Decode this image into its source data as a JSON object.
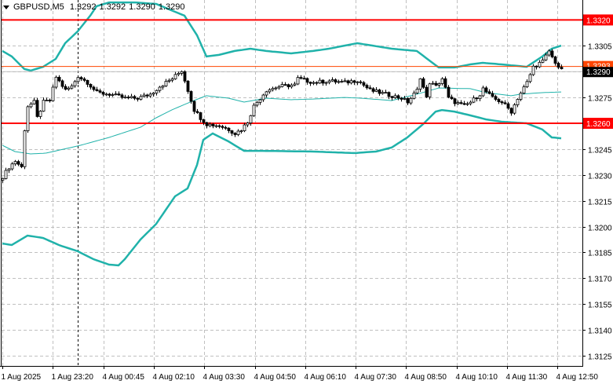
{
  "header": {
    "symbol": "GBPUSD,M5",
    "open": "1.3292",
    "high": "1.3292",
    "low": "1.3290",
    "close": "1.3290"
  },
  "colors": {
    "band": "#20b2aa",
    "level": "#ff0000",
    "bid_line": "#ff4500",
    "last_line": "#c0c0c0",
    "grid": "#c0c0c0",
    "candle_up": "#ffffff",
    "candle_down": "#000000"
  },
  "chart_data": {
    "type": "candlestick",
    "title": "GBPUSD,M5",
    "ylim": [
      1.3118,
      1.3332
    ],
    "y_ticks": [
      "1.3305",
      "1.3290",
      "1.3275",
      "1.3260",
      "1.3245",
      "1.3230",
      "1.3215",
      "1.3200",
      "1.3185",
      "1.3170",
      "1.3155",
      "1.3140",
      "1.3125"
    ],
    "x_ticks": [
      "1 Aug 2025",
      "1 Aug 23:20",
      "4 Aug 00:45",
      "4 Aug 02:10",
      "4 Aug 03:30",
      "4 Aug 04:50",
      "4 Aug 06:10",
      "4 Aug 07:30",
      "4 Aug 08:50",
      "4 Aug 10:10",
      "4 Aug 11:30",
      "4 Aug 12:50"
    ],
    "bar_count": 179,
    "close_keypoints": [
      [
        0,
        1.3229
      ],
      [
        2,
        1.32345
      ],
      [
        4,
        1.32381
      ],
      [
        6,
        1.32345
      ],
      [
        7,
        1.32564
      ],
      [
        8,
        1.327
      ],
      [
        10,
        1.32723
      ],
      [
        11,
        1.32632
      ],
      [
        13,
        1.32723
      ],
      [
        15,
        1.32732
      ],
      [
        17,
        1.32869
      ],
      [
        20,
        1.32792
      ],
      [
        22,
        1.32814
      ],
      [
        24,
        1.32874
      ],
      [
        27,
        1.32837
      ],
      [
        30,
        1.32778
      ],
      [
        34,
        1.32769
      ],
      [
        39,
        1.32746
      ],
      [
        43,
        1.32746
      ],
      [
        47,
        1.32769
      ],
      [
        50,
        1.32814
      ],
      [
        54,
        1.3286
      ],
      [
        57,
        1.32906
      ],
      [
        59,
        1.32792
      ],
      [
        61,
        1.32678
      ],
      [
        63,
        1.32632
      ],
      [
        65,
        1.32595
      ],
      [
        69,
        1.32586
      ],
      [
        72,
        1.32564
      ],
      [
        74,
        1.32541
      ],
      [
        76,
        1.32564
      ],
      [
        78,
        1.32609
      ],
      [
        80,
        1.327
      ],
      [
        82,
        1.32746
      ],
      [
        84,
        1.32792
      ],
      [
        88,
        1.32814
      ],
      [
        93,
        1.32823
      ],
      [
        94,
        1.3286
      ],
      [
        99,
        1.32837
      ],
      [
        104,
        1.32846
      ],
      [
        109,
        1.32837
      ],
      [
        113,
        1.32851
      ],
      [
        117,
        1.32792
      ],
      [
        122,
        1.32769
      ],
      [
        127,
        1.32746
      ],
      [
        129,
        1.32723
      ],
      [
        132,
        1.32792
      ],
      [
        133,
        1.32869
      ],
      [
        135,
        1.32746
      ],
      [
        136,
        1.32837
      ],
      [
        138,
        1.32814
      ],
      [
        140,
        1.3286
      ],
      [
        142,
        1.32746
      ],
      [
        144,
        1.32723
      ],
      [
        147,
        1.327
      ],
      [
        149,
        1.32723
      ],
      [
        152,
        1.32769
      ],
      [
        153,
        1.32801
      ],
      [
        156,
        1.32746
      ],
      [
        159,
        1.32723
      ],
      [
        162,
        1.32668
      ],
      [
        164,
        1.32746
      ],
      [
        167,
        1.32837
      ],
      [
        169,
        1.32928
      ],
      [
        172,
        1.3296
      ],
      [
        174,
        1.3302
      ],
      [
        175,
        1.32983
      ],
      [
        177,
        1.32928
      ],
      [
        178,
        1.32906
      ]
    ],
    "bollinger_upper": [
      [
        0,
        1.3302
      ],
      [
        3,
        1.32988
      ],
      [
        7,
        1.32915
      ],
      [
        9,
        1.32906
      ],
      [
        13,
        1.32928
      ],
      [
        17,
        1.32974
      ],
      [
        20,
        1.33065
      ],
      [
        24,
        1.33134
      ],
      [
        28,
        1.33225
      ],
      [
        30,
        1.3328
      ],
      [
        34,
        1.33302
      ],
      [
        42,
        1.33302
      ],
      [
        49,
        1.33293
      ],
      [
        58,
        1.33225
      ],
      [
        62,
        1.33111
      ],
      [
        65,
        1.32988
      ],
      [
        69,
        1.32997
      ],
      [
        74,
        1.3302
      ],
      [
        79,
        1.33033
      ],
      [
        84,
        1.3302
      ],
      [
        92,
        1.33006
      ],
      [
        99,
        1.3302
      ],
      [
        104,
        1.33033
      ],
      [
        113,
        1.33065
      ],
      [
        118,
        1.33051
      ],
      [
        124,
        1.33033
      ],
      [
        132,
        1.3302
      ],
      [
        137,
        1.32951
      ],
      [
        139,
        1.32924
      ],
      [
        144,
        1.32924
      ],
      [
        149,
        1.32942
      ],
      [
        153,
        1.32951
      ],
      [
        159,
        1.32942
      ],
      [
        167,
        1.32928
      ],
      [
        172,
        1.32988
      ],
      [
        175,
        1.33033
      ],
      [
        178,
        1.33051
      ]
    ],
    "bollinger_middle": [
      [
        0,
        1.32472
      ],
      [
        4,
        1.32436
      ],
      [
        9,
        1.32422
      ],
      [
        14,
        1.32427
      ],
      [
        24,
        1.32468
      ],
      [
        34,
        1.32518
      ],
      [
        44,
        1.32577
      ],
      [
        49,
        1.32632
      ],
      [
        54,
        1.32678
      ],
      [
        61,
        1.32732
      ],
      [
        65,
        1.3276
      ],
      [
        72,
        1.32746
      ],
      [
        77,
        1.32723
      ],
      [
        84,
        1.32746
      ],
      [
        92,
        1.32737
      ],
      [
        99,
        1.32741
      ],
      [
        109,
        1.3275
      ],
      [
        114,
        1.32746
      ],
      [
        124,
        1.32732
      ],
      [
        132,
        1.32769
      ],
      [
        139,
        1.32805
      ],
      [
        149,
        1.32801
      ],
      [
        154,
        1.32778
      ],
      [
        162,
        1.3276
      ],
      [
        165,
        1.32769
      ],
      [
        172,
        1.32778
      ],
      [
        178,
        1.32782
      ]
    ],
    "bollinger_lower": [
      [
        0,
        1.31902
      ],
      [
        3,
        1.31893
      ],
      [
        8,
        1.31948
      ],
      [
        13,
        1.31934
      ],
      [
        18,
        1.31893
      ],
      [
        24,
        1.31857
      ],
      [
        29,
        1.31811
      ],
      [
        34,
        1.31779
      ],
      [
        37,
        1.31775
      ],
      [
        39,
        1.31811
      ],
      [
        44,
        1.31925
      ],
      [
        49,
        1.32016
      ],
      [
        55,
        1.32176
      ],
      [
        59,
        1.32222
      ],
      [
        62,
        1.32358
      ],
      [
        64,
        1.32504
      ],
      [
        67,
        1.32541
      ],
      [
        72,
        1.32495
      ],
      [
        77,
        1.3244
      ],
      [
        82,
        1.3244
      ],
      [
        99,
        1.32436
      ],
      [
        112,
        1.32427
      ],
      [
        119,
        1.32436
      ],
      [
        124,
        1.32459
      ],
      [
        129,
        1.32518
      ],
      [
        134,
        1.32595
      ],
      [
        138,
        1.32668
      ],
      [
        140,
        1.32677
      ],
      [
        144,
        1.32668
      ],
      [
        149,
        1.32646
      ],
      [
        154,
        1.32623
      ],
      [
        159,
        1.32609
      ],
      [
        167,
        1.326
      ],
      [
        172,
        1.32564
      ],
      [
        175,
        1.32518
      ],
      [
        178,
        1.32513
      ]
    ],
    "levels": [
      {
        "price": 1.332,
        "label": "1.3320"
      },
      {
        "price": 1.326,
        "label": "1.3260"
      }
    ],
    "bid": {
      "price": 1.3293,
      "label": "1.3293"
    },
    "last": {
      "price": 1.329,
      "label": "1.3290"
    },
    "separator_bar": 24
  }
}
